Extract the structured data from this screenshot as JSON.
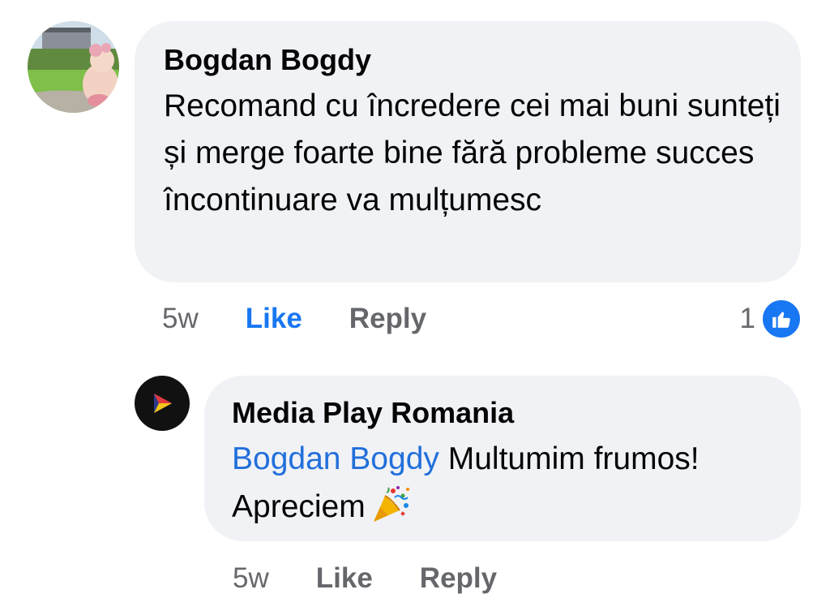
{
  "comment": {
    "author": "Bogdan Bogdy",
    "text": "Recomand cu încredere cei mai buni sunteți și merge foarte bine fără probleme succes încontinuare va mulțumesc",
    "time": "5w",
    "like_label": "Like",
    "reply_label": "Reply",
    "reaction_count": "1",
    "reaction_type": "like-icon",
    "liked": true
  },
  "reply": {
    "author": "Media Play Romania",
    "mention": "Bogdan Bogdy",
    "text": "Multumim frumos! Apreciem",
    "emoji": "party-popper-icon",
    "time": "5w",
    "like_label": "Like",
    "reply_label": "Reply"
  },
  "colors": {
    "bubble": "#f0f2f5",
    "liked_blue": "#1877f2",
    "mention_blue": "#216fdb",
    "meta_gray": "#65676b"
  }
}
